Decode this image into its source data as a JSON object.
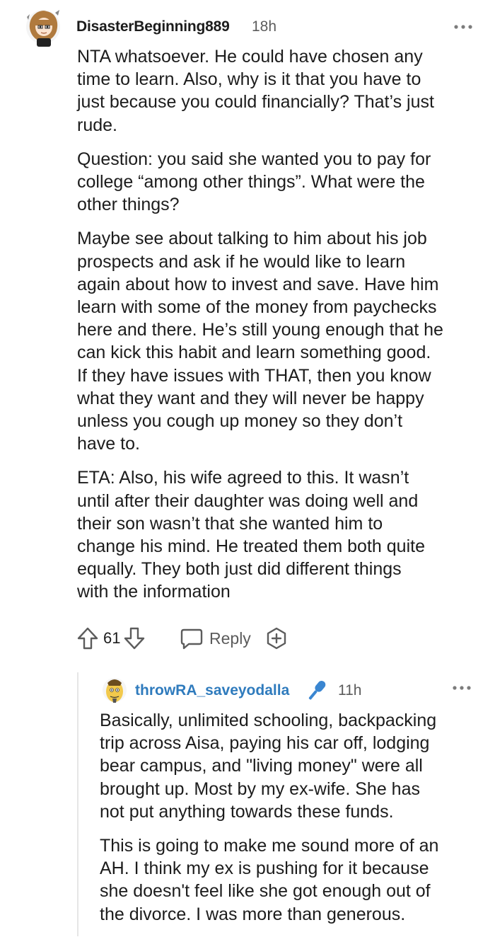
{
  "comment": {
    "username": "DisasterBeginning889",
    "timestamp": "18h",
    "paragraphs": [
      "NTA whatsoever. He could have chosen any\ntime to learn. Also, why is it that you have to\njust because you could financially? That’s just\nrude.",
      "Question: you said she wanted you to pay for\ncollege “among other things”. What were the\nother things?",
      "Maybe see about talking to him about his job\nprospects and ask if he would like to learn\nagain about how to invest and save. Have him\nlearn with some of the money from paychecks\nhere and there. He’s still young enough that he\ncan kick this habit and learn something good.\nIf they have issues with THAT, then you know\nwhat they want and they will never be happy\nunless you cough up money so they don’t\nhave to.",
      "ETA: Also, his wife agreed to this. It wasn’t\nuntil after their daughter was doing well and\ntheir son wasn’t that she wanted him to\nchange his mind. He treated them both quite\nequally. They both just did different things\nwith the information"
    ],
    "vote_count": "61",
    "reply_label": "Reply",
    "icons": {
      "avatar": "user-avatar",
      "more": "more-options-icon",
      "upvote": "upvote-arrow-icon",
      "downvote": "downvote-arrow-icon",
      "reply": "reply-bubble-icon",
      "award": "award-plus-icon"
    }
  },
  "reply": {
    "username": "throwRA_saveyodalla",
    "timestamp": "11h",
    "username_color": "#2f7bbd",
    "paragraphs": [
      "Basically, unlimited schooling, backpacking\ntrip across Aisa, paying his car off, lodging\nbear campus, and \"living money\" were all\nbrought up. Most by my ex-wife. She has\nnot put anything towards these funds.",
      "This is going to make me sound more of an\nAH. I think my ex is pushing for it because\nshe doesn't feel like she got enough out of\nthe divorce. I was more than generous."
    ],
    "icons": {
      "avatar": "user-avatar",
      "op_badge": "microphone-icon",
      "more": "more-options-icon"
    }
  }
}
